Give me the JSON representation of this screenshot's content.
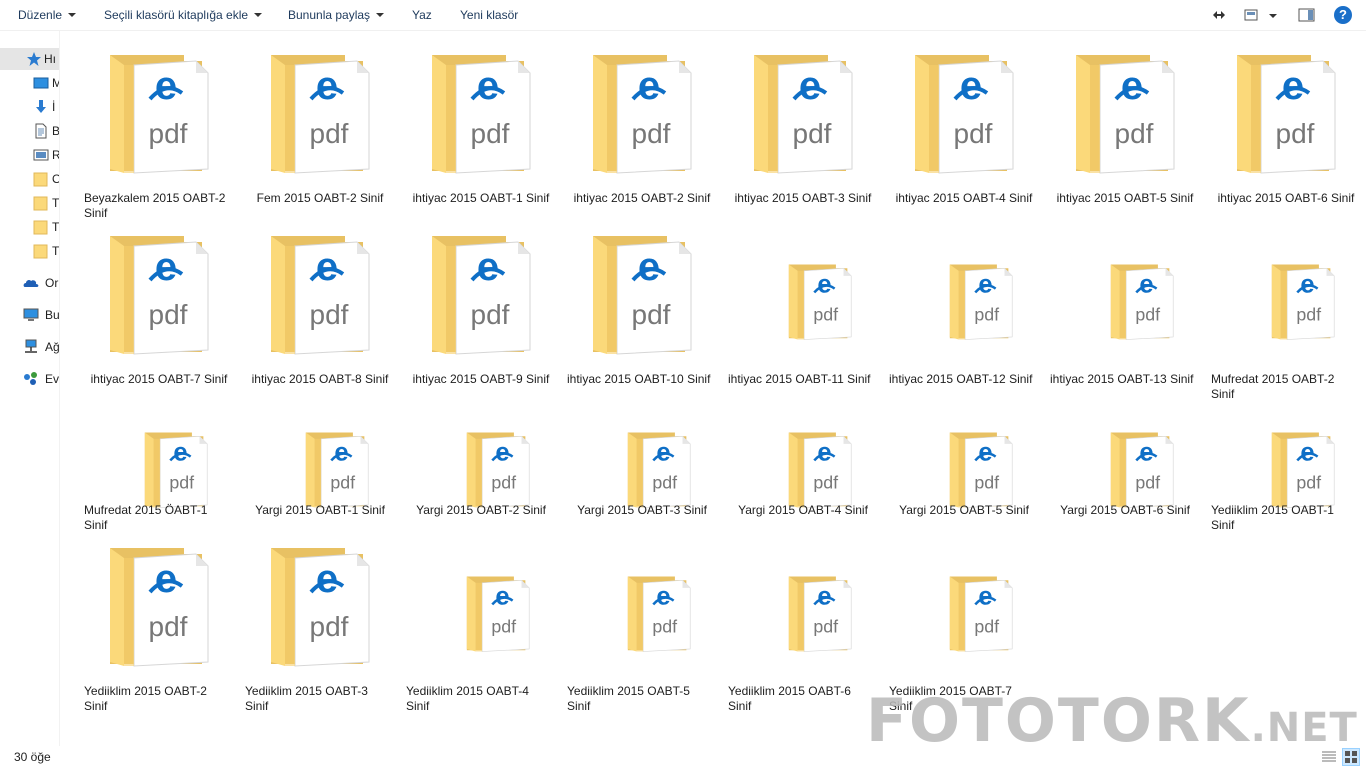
{
  "toolbar": {
    "organize_label": "Düzenle",
    "include_library_label": "Seçili klasörü kitaplığa ekle",
    "share_label": "Bununla paylaş",
    "burn_label": "Yaz",
    "new_folder_label": "Yeni klasör",
    "help_label": "?"
  },
  "nav": {
    "items": [
      {
        "label": "Hı",
        "icon": "star-icon"
      },
      {
        "label": "M",
        "icon": "desktop-icon"
      },
      {
        "label": "İ",
        "icon": "downloads-icon"
      },
      {
        "label": "B",
        "icon": "document-icon"
      },
      {
        "label": "R",
        "icon": "pictures-icon"
      },
      {
        "label": "O",
        "icon": "folder-icon"
      },
      {
        "label": "T",
        "icon": "folder-icon"
      },
      {
        "label": "T",
        "icon": "folder-icon"
      },
      {
        "label": "T",
        "icon": "folder-icon"
      },
      {
        "label": "Or",
        "icon": "onedrive-icon"
      },
      {
        "label": "Bu",
        "icon": "this-pc-icon"
      },
      {
        "label": "Ağ",
        "icon": "network-icon"
      },
      {
        "label": "Ev",
        "icon": "homegroup-icon"
      }
    ]
  },
  "files": [
    {
      "name": "Beyazkalem 2015 OABT-2 Sinif",
      "size": "large"
    },
    {
      "name": "Fem 2015 OABT-2 Sinif",
      "size": "large"
    },
    {
      "name": "ihtiyac 2015 OABT-1 Sinif",
      "size": "large"
    },
    {
      "name": "ihtiyac 2015 OABT-2 Sinif",
      "size": "large"
    },
    {
      "name": "ihtiyac 2015 OABT-3 Sinif",
      "size": "large"
    },
    {
      "name": "ihtiyac 2015 OABT-4 Sinif",
      "size": "large"
    },
    {
      "name": "ihtiyac 2015 OABT-5 Sinif",
      "size": "large"
    },
    {
      "name": "ihtiyac 2015 OABT-6 Sinif",
      "size": "large"
    },
    {
      "name": "ihtiyac 2015 OABT-7 Sinif",
      "size": "large"
    },
    {
      "name": "ihtiyac 2015 OABT-8 Sinif",
      "size": "large"
    },
    {
      "name": "ihtiyac 2015 OABT-9 Sinif",
      "size": "large"
    },
    {
      "name": "ihtiyac 2015 OABT-10 Sinif",
      "size": "large"
    },
    {
      "name": "ihtiyac 2015 OABT-11 Sinif",
      "size": "small"
    },
    {
      "name": "ihtiyac 2015 OABT-12 Sinif",
      "size": "small"
    },
    {
      "name": "ihtiyac 2015 OABT-13 Sinif",
      "size": "small"
    },
    {
      "name": "Mufredat 2015 OABT-2 Sinif",
      "size": "small"
    },
    {
      "name": "Mufredat 2015 ÖABT-1 Sinif",
      "size": "small"
    },
    {
      "name": "Yargi 2015 OABT-1 Sinif",
      "size": "small"
    },
    {
      "name": "Yargi 2015 OABT-2 Sinif",
      "size": "small"
    },
    {
      "name": "Yargi 2015 OABT-3 Sinif",
      "size": "small"
    },
    {
      "name": "Yargi 2015 OABT-4 Sinif",
      "size": "small"
    },
    {
      "name": "Yargi 2015 OABT-5 Sinif",
      "size": "small"
    },
    {
      "name": "Yargi 2015 OABT-6 Sinif",
      "size": "small"
    },
    {
      "name": "Yediiklim 2015 OABT-1 Sinif",
      "size": "small"
    },
    {
      "name": "Yediiklim 2015 OABT-2 Sinif",
      "size": "large"
    },
    {
      "name": "Yediiklim 2015 OABT-3 Sinif",
      "size": "large"
    },
    {
      "name": "Yediiklim 2015 OABT-4 Sinif",
      "size": "small"
    },
    {
      "name": "Yediiklim 2015 OABT-5 Sinif",
      "size": "small"
    },
    {
      "name": "Yediiklim 2015 OABT-6 Sinif",
      "size": "small"
    },
    {
      "name": "Yediiklim 2015 OABT-7 Sinif",
      "size": "small"
    }
  ],
  "thumb_text": "pdf",
  "status": {
    "item_count": "30 öğe"
  },
  "watermark": {
    "main": "FOTOTORK",
    "suffix": ".NET"
  },
  "colors": {
    "folder_back": "#e8c163",
    "folder_front": "#fbd97a",
    "edge_blue": "#0f6fc6",
    "pdf_gray": "#777777",
    "accent": "#1e3a5c"
  }
}
